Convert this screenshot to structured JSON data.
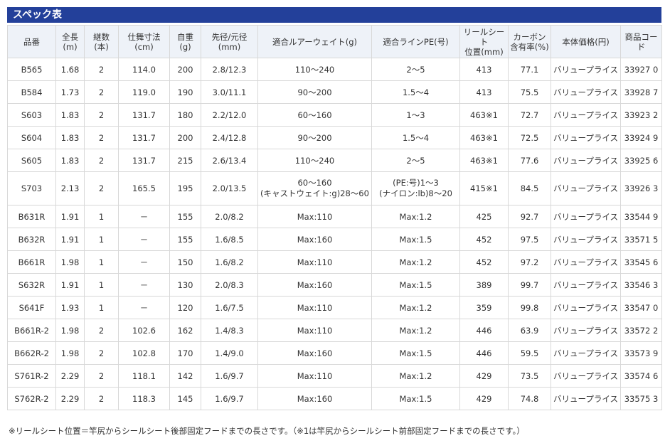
{
  "title": "スペック表",
  "headers": [
    [
      "品番"
    ],
    [
      "全長(m)"
    ],
    [
      "継数(本)"
    ],
    [
      "仕舞寸法(cm)"
    ],
    [
      "自重(g)"
    ],
    [
      "先径/元径(mm)"
    ],
    [
      "適合ルアーウェイト(g)"
    ],
    [
      "適合ラインPE(号)"
    ],
    [
      "リールシート",
      "位置(mm)"
    ],
    [
      "カーボン",
      "含有率(%)"
    ],
    [
      "本体価格(円)"
    ],
    [
      "商品コード"
    ]
  ],
  "rows": [
    [
      [
        "B565"
      ],
      [
        "1.68"
      ],
      [
        "2"
      ],
      [
        "114.0"
      ],
      [
        "200"
      ],
      [
        "2.8/12.3"
      ],
      [
        "110～240"
      ],
      [
        "2～5"
      ],
      [
        "413"
      ],
      [
        "77.1"
      ],
      [
        "バリュープライス"
      ],
      [
        "33927 0"
      ]
    ],
    [
      [
        "B584"
      ],
      [
        "1.73"
      ],
      [
        "2"
      ],
      [
        "119.0"
      ],
      [
        "190"
      ],
      [
        "3.0/11.1"
      ],
      [
        "90～200"
      ],
      [
        "1.5～4"
      ],
      [
        "413"
      ],
      [
        "75.5"
      ],
      [
        "バリュープライス"
      ],
      [
        "33928 7"
      ]
    ],
    [
      [
        "S603"
      ],
      [
        "1.83"
      ],
      [
        "2"
      ],
      [
        "131.7"
      ],
      [
        "180"
      ],
      [
        "2.2/12.0"
      ],
      [
        "60～160"
      ],
      [
        "1～3"
      ],
      [
        "463※1"
      ],
      [
        "72.7"
      ],
      [
        "バリュープライス"
      ],
      [
        "33923 2"
      ]
    ],
    [
      [
        "S604"
      ],
      [
        "1.83"
      ],
      [
        "2"
      ],
      [
        "131.7"
      ],
      [
        "200"
      ],
      [
        "2.4/12.8"
      ],
      [
        "90～200"
      ],
      [
        "1.5～4"
      ],
      [
        "463※1"
      ],
      [
        "72.5"
      ],
      [
        "バリュープライス"
      ],
      [
        "33924 9"
      ]
    ],
    [
      [
        "S605"
      ],
      [
        "1.83"
      ],
      [
        "2"
      ],
      [
        "131.7"
      ],
      [
        "215"
      ],
      [
        "2.6/13.4"
      ],
      [
        "110～240"
      ],
      [
        "2～5"
      ],
      [
        "463※1"
      ],
      [
        "77.6"
      ],
      [
        "バリュープライス"
      ],
      [
        "33925 6"
      ]
    ],
    [
      [
        "S703"
      ],
      [
        "2.13"
      ],
      [
        "2"
      ],
      [
        "165.5"
      ],
      [
        "195"
      ],
      [
        "2.0/13.5"
      ],
      [
        "60～160",
        "(キャストウェイト:g)28～60"
      ],
      [
        "(PE:号)1～3",
        "(ナイロン:lb)8～20"
      ],
      [
        "415※1"
      ],
      [
        "84.5"
      ],
      [
        "バリュープライス"
      ],
      [
        "33926 3"
      ]
    ],
    [
      [
        "B631R"
      ],
      [
        "1.91"
      ],
      [
        "1"
      ],
      [
        "－"
      ],
      [
        "155"
      ],
      [
        "2.0/8.2"
      ],
      [
        "Max:110"
      ],
      [
        "Max:1.2"
      ],
      [
        "425"
      ],
      [
        "92.7"
      ],
      [
        "バリュープライス"
      ],
      [
        "33544 9"
      ]
    ],
    [
      [
        "B632R"
      ],
      [
        "1.91"
      ],
      [
        "1"
      ],
      [
        "－"
      ],
      [
        "155"
      ],
      [
        "1.6/8.5"
      ],
      [
        "Max:160"
      ],
      [
        "Max:1.5"
      ],
      [
        "452"
      ],
      [
        "97.5"
      ],
      [
        "バリュープライス"
      ],
      [
        "33571 5"
      ]
    ],
    [
      [
        "B661R"
      ],
      [
        "1.98"
      ],
      [
        "1"
      ],
      [
        "－"
      ],
      [
        "150"
      ],
      [
        "1.6/8.2"
      ],
      [
        "Max:110"
      ],
      [
        "Max:1.2"
      ],
      [
        "452"
      ],
      [
        "97.2"
      ],
      [
        "バリュープライス"
      ],
      [
        "33545 6"
      ]
    ],
    [
      [
        "S632R"
      ],
      [
        "1.91"
      ],
      [
        "1"
      ],
      [
        "－"
      ],
      [
        "130"
      ],
      [
        "2.0/8.3"
      ],
      [
        "Max:160"
      ],
      [
        "Max:1.5"
      ],
      [
        "389"
      ],
      [
        "99.7"
      ],
      [
        "バリュープライス"
      ],
      [
        "33546 3"
      ]
    ],
    [
      [
        "S641F"
      ],
      [
        "1.93"
      ],
      [
        "1"
      ],
      [
        "－"
      ],
      [
        "120"
      ],
      [
        "1.6/7.5"
      ],
      [
        "Max:110"
      ],
      [
        "Max:1.2"
      ],
      [
        "359"
      ],
      [
        "99.8"
      ],
      [
        "バリュープライス"
      ],
      [
        "33547 0"
      ]
    ],
    [
      [
        "B661R-2"
      ],
      [
        "1.98"
      ],
      [
        "2"
      ],
      [
        "102.6"
      ],
      [
        "162"
      ],
      [
        "1.4/8.3"
      ],
      [
        "Max:110"
      ],
      [
        "Max:1.2"
      ],
      [
        "446"
      ],
      [
        "63.9"
      ],
      [
        "バリュープライス"
      ],
      [
        "33572 2"
      ]
    ],
    [
      [
        "B662R-2"
      ],
      [
        "1.98"
      ],
      [
        "2"
      ],
      [
        "102.8"
      ],
      [
        "170"
      ],
      [
        "1.4/9.0"
      ],
      [
        "Max:160"
      ],
      [
        "Max:1.5"
      ],
      [
        "446"
      ],
      [
        "59.5"
      ],
      [
        "バリュープライス"
      ],
      [
        "33573 9"
      ]
    ],
    [
      [
        "S761R-2"
      ],
      [
        "2.29"
      ],
      [
        "2"
      ],
      [
        "118.1"
      ],
      [
        "142"
      ],
      [
        "1.6/9.7"
      ],
      [
        "Max:110"
      ],
      [
        "Max:1.2"
      ],
      [
        "429"
      ],
      [
        "73.5"
      ],
      [
        "バリュープライス"
      ],
      [
        "33574 6"
      ]
    ],
    [
      [
        "S762R-2"
      ],
      [
        "2.29"
      ],
      [
        "2"
      ],
      [
        "118.3"
      ],
      [
        "145"
      ],
      [
        "1.6/9.7"
      ],
      [
        "Max:160"
      ],
      [
        "Max:1.5"
      ],
      [
        "429"
      ],
      [
        "74.8"
      ],
      [
        "バリュープライス"
      ],
      [
        "33575 3"
      ]
    ]
  ],
  "note": "※リールシート位置＝竿尻からシールシート後部固定フードまでの長さです。（※1は竿尻からシールシート前部固定フードまでの長さです。）",
  "colors": {
    "title_bg": "#23409a",
    "header_bg": "#eef2f8",
    "border": "#d8d8d8"
  }
}
